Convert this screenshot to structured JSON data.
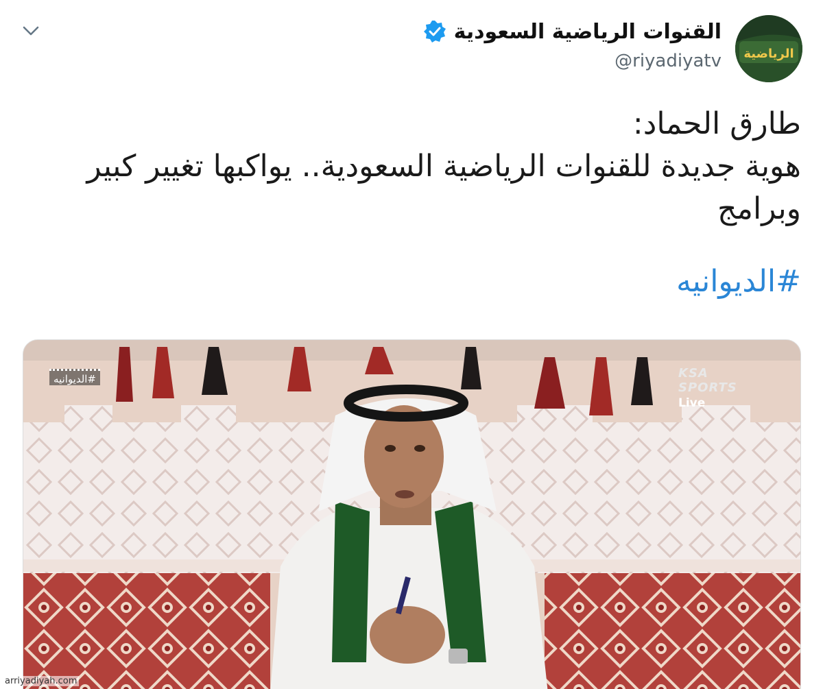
{
  "tweet": {
    "display_name": "القنوات الرياضية السعودية",
    "handle": "@riyadiyatv",
    "avatar_text": "الرياضية",
    "text_lines": [
      "طارق الحماد:",
      "هوية جديدة للقنوات الرياضية السعودية.. يواكبها تغيير كبير",
      "وبرامج"
    ],
    "hashtag": "#الديوانيه",
    "icons": {
      "options": "chevron-down-icon",
      "verified": "verified-badge-icon"
    },
    "colors": {
      "hashtag": "#2a86d6",
      "verified": "#1d9bf0",
      "handle": "#5b6770"
    }
  },
  "media": {
    "program_tag": "#الديوانيه",
    "channel_brand": "KSA SPORTS",
    "live_label": "Live"
  },
  "footer": {
    "watermark": "arriyadiyah.com"
  }
}
